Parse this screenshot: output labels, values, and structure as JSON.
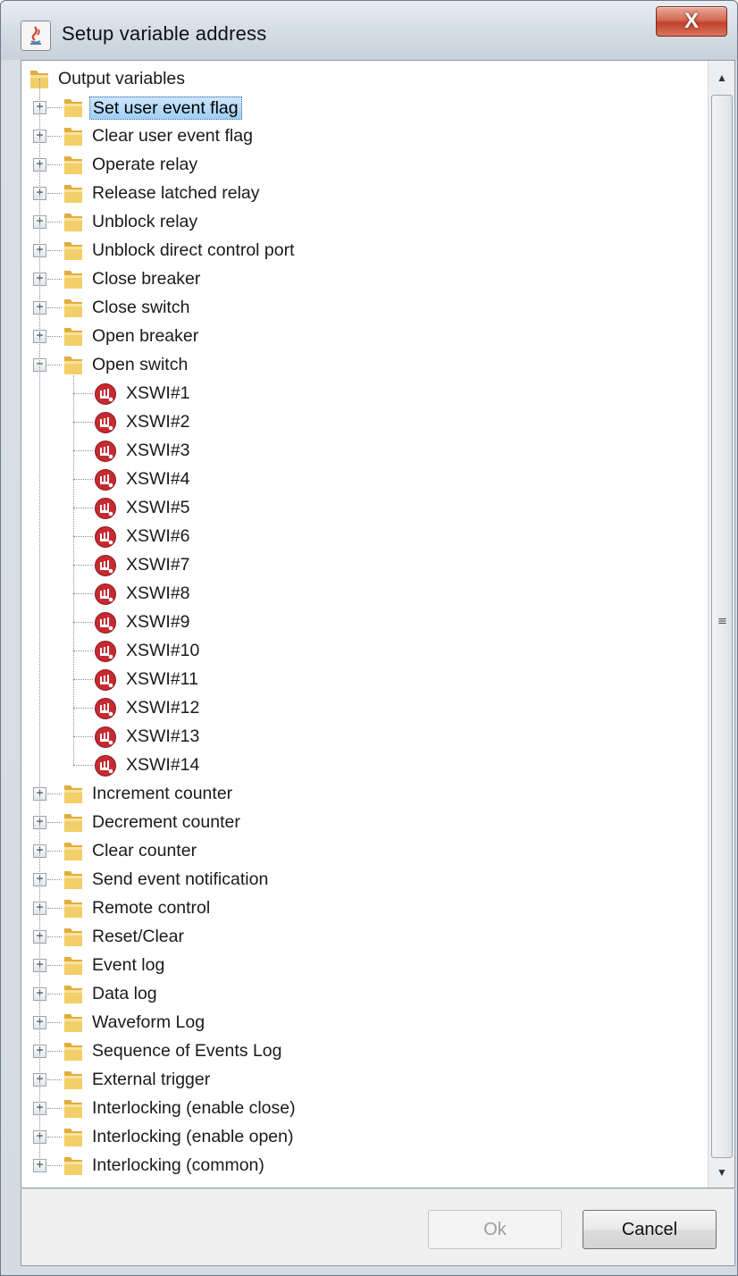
{
  "window": {
    "title": "Setup variable address",
    "close_label": "X"
  },
  "tree": {
    "root_label": "Output variables",
    "groups_before": [
      {
        "label": "Set user event flag",
        "selected": true
      },
      {
        "label": "Clear user event flag"
      },
      {
        "label": "Operate relay"
      },
      {
        "label": "Release latched relay"
      },
      {
        "label": "Unblock relay"
      },
      {
        "label": "Unblock direct control port"
      },
      {
        "label": "Close breaker"
      },
      {
        "label": "Close switch"
      },
      {
        "label": "Open breaker"
      }
    ],
    "expanded_group": {
      "label": "Open switch",
      "children": [
        "XSWI#1",
        "XSWI#2",
        "XSWI#3",
        "XSWI#4",
        "XSWI#5",
        "XSWI#6",
        "XSWI#7",
        "XSWI#8",
        "XSWI#9",
        "XSWI#10",
        "XSWI#11",
        "XSWI#12",
        "XSWI#13",
        "XSWI#14"
      ]
    },
    "groups_after": [
      {
        "label": "Increment counter"
      },
      {
        "label": "Decrement counter"
      },
      {
        "label": "Clear counter"
      },
      {
        "label": "Send event notification"
      },
      {
        "label": "Remote control"
      },
      {
        "label": "Reset/Clear"
      },
      {
        "label": "Event log"
      },
      {
        "label": "Data log"
      },
      {
        "label": "Waveform Log"
      },
      {
        "label": "Sequence of Events Log"
      },
      {
        "label": "External trigger"
      },
      {
        "label": "Interlocking (enable close)"
      },
      {
        "label": "Interlocking (enable open)"
      },
      {
        "label": "Interlocking (common)"
      }
    ],
    "icons": {
      "group": "folder-icon",
      "leaf": "logical-node-icon",
      "collapsed": "plus-expander-icon",
      "expanded": "minus-expander-icon"
    }
  },
  "buttons": {
    "ok_label": "Ok",
    "ok_enabled": false,
    "cancel_label": "Cancel"
  },
  "colors": {
    "selection": "#a8d4f8",
    "close_button": "#c7432b",
    "folder": "#e8b84a",
    "leaf_icon": "#c4262e"
  }
}
